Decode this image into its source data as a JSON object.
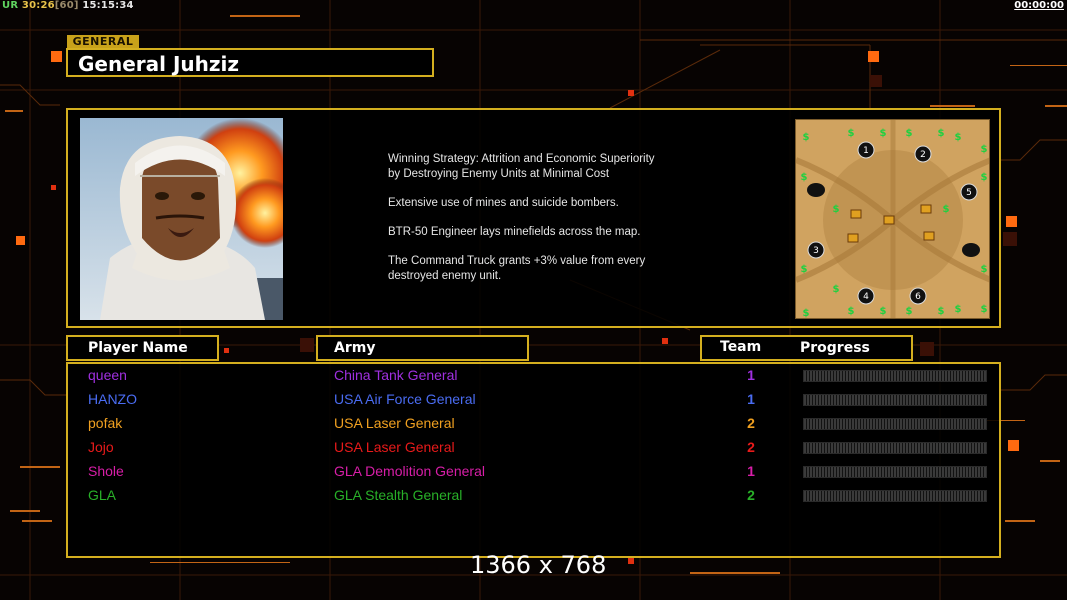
{
  "hud": {
    "ur_label": "UR",
    "time_a": "30",
    "time_b": ":26",
    "fps": "[60]",
    "clock": "15:15:34",
    "timer": "00:00:00"
  },
  "general": {
    "tag": "GENERAL",
    "name": "General Juhziz",
    "description": [
      "Winning Strategy: Attrition and Economic Superiority\n by Destroying Enemy Units at Minimal Cost",
      "Extensive use of mines and suicide bombers.",
      "BTR-50 Engineer lays minefields across the map.",
      "The Command Truck grants +3% value from every\n destroyed enemy unit."
    ]
  },
  "minimap": {
    "start_positions": [
      "1",
      "2",
      "3",
      "4",
      "5",
      "6"
    ],
    "resource_symbol": "$"
  },
  "table": {
    "headers": {
      "player": "Player Name",
      "army": "Army",
      "team": "Team",
      "progress": "Progress"
    },
    "rows": [
      {
        "name": "queen",
        "army": "China Tank General",
        "team": "1",
        "color": "#a030e0",
        "progress": 0
      },
      {
        "name": "HANZO",
        "army": "USA Air Force General",
        "team": "1",
        "color": "#4a6cf2",
        "progress": 0
      },
      {
        "name": "pofak",
        "army": "USA Laser General",
        "team": "2",
        "color": "#f0a020",
        "progress": 0
      },
      {
        "name": "Jojo",
        "army": "USA Laser General",
        "team": "2",
        "color": "#e81a1a",
        "progress": 0
      },
      {
        "name": "Shole",
        "army": "GLA Demolition General",
        "team": "1",
        "color": "#d81ea8",
        "progress": 0
      },
      {
        "name": "GLA",
        "army": "GLA Stealth General",
        "team": "2",
        "color": "#28b028",
        "progress": 0
      }
    ]
  },
  "resolution": "1366 x 768",
  "colors": {
    "accent_gold": "#d4af1f",
    "bg_orange": "#ff6a10"
  }
}
